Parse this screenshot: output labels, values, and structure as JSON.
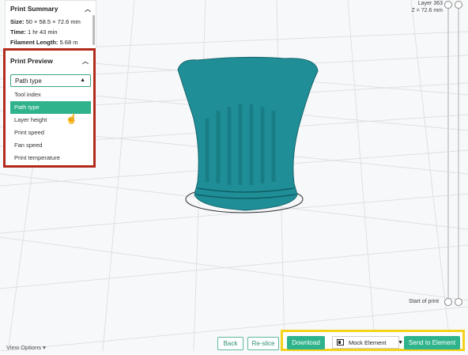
{
  "print_summary": {
    "title": "Print Summary",
    "size_label": "Size:",
    "size_value": "50 × 58.5 × 72.6 mm",
    "time_label": "Time:",
    "time_value": "1 hr 43 min",
    "filament_label": "Filament Length:",
    "filament_value": "5.68 m"
  },
  "print_preview": {
    "title": "Print Preview",
    "selected": "Path type",
    "options": [
      "Tool index",
      "Path type",
      "Layer height",
      "Print speed",
      "Fan speed",
      "Print temperature"
    ]
  },
  "layer_slider": {
    "layer_label": "Layer 363",
    "z_label": "Z = 72.6 mm",
    "start_label": "Start of print"
  },
  "view_options": "View Options",
  "buttons": {
    "back": "Back",
    "reslice": "Re-slice",
    "download": "Download",
    "device": "Mock Element",
    "send": "Send to Element"
  },
  "colors": {
    "accent": "#2fb38c",
    "model": "#1e8a93",
    "highlight_red": "#b22a1c",
    "highlight_yellow": "#f3d31b"
  }
}
